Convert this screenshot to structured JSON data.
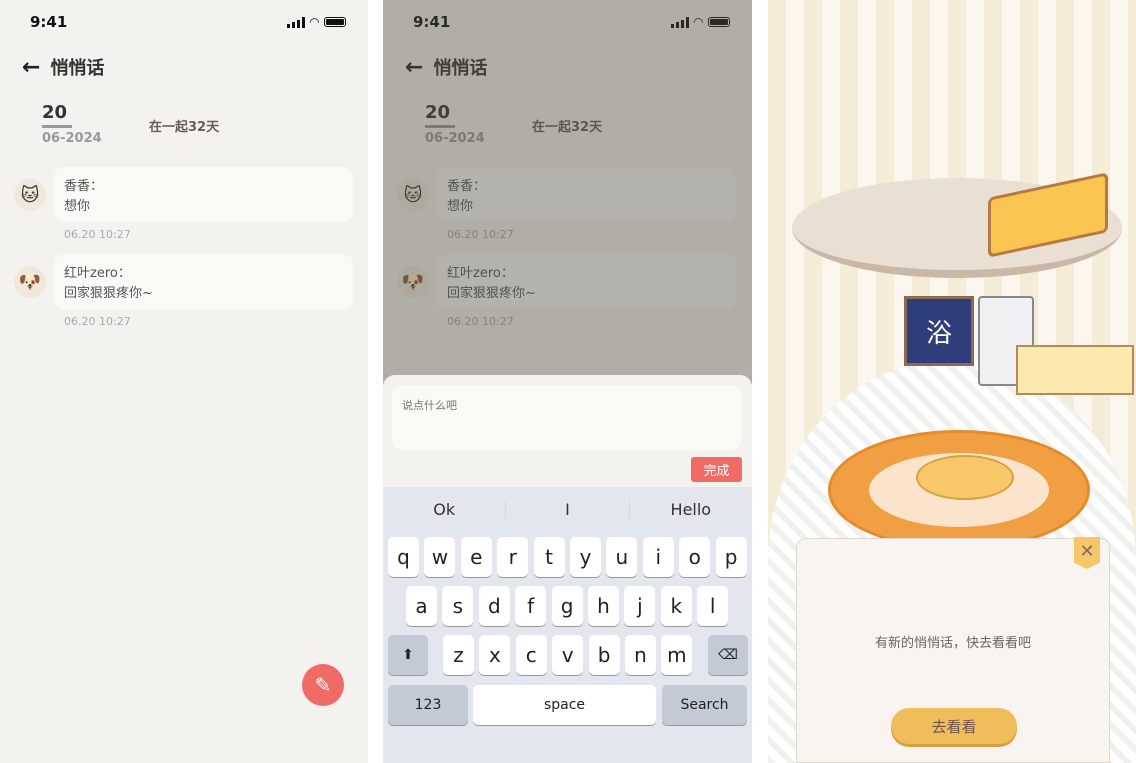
{
  "status": {
    "time": "9:41"
  },
  "header": {
    "back_icon": "arrow-left-icon",
    "title": "悄悄话"
  },
  "date": {
    "day": "20",
    "month_year": "06-2024",
    "together": "在一起32天"
  },
  "messages": [
    {
      "sender": "香香：",
      "text": "想你",
      "time": "06.20 10:27",
      "avatar": "cat"
    },
    {
      "sender": "红叶zero：",
      "text": "回家狠狠疼你~",
      "time": "06.20 10:27",
      "avatar": "corgi"
    }
  ],
  "fab": {
    "icon": "pencil-icon"
  },
  "compose": {
    "placeholder": "说点什么吧",
    "done_label": "完成"
  },
  "keyboard": {
    "suggestions": [
      "Ok",
      "I",
      "Hello"
    ],
    "row1": [
      "q",
      "w",
      "e",
      "r",
      "t",
      "y",
      "u",
      "i",
      "o",
      "p"
    ],
    "row2": [
      "a",
      "s",
      "d",
      "f",
      "g",
      "h",
      "j",
      "k",
      "l"
    ],
    "row3": [
      "z",
      "x",
      "c",
      "v",
      "b",
      "n",
      "m"
    ],
    "numbers": "123",
    "space": "space",
    "search": "Search"
  },
  "room": {
    "door_sign": "浴"
  },
  "popup": {
    "message": "有新的悄悄话，快去看看吧",
    "button": "去看看"
  },
  "colors": {
    "accent": "#f06b66",
    "popup_button": "#f0bd5c",
    "background": "#f4f2ee"
  }
}
